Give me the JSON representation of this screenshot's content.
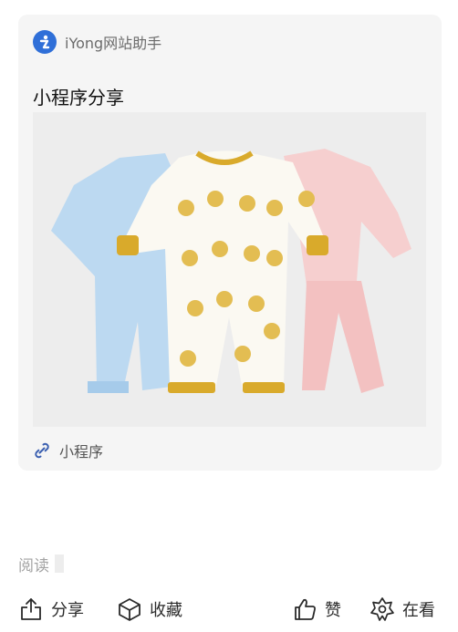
{
  "card": {
    "app_name": "iYong网站助手",
    "title": "小程序分享",
    "mini_program_label": "小程序",
    "thumbnail_icon": "baby-clothes-product-photo",
    "colors": {
      "logo": "#2f6fd8",
      "link_icon": "#3a5fb0"
    }
  },
  "reading": {
    "label": "阅读"
  },
  "actions": {
    "share": {
      "label": "分享",
      "icon": "share-icon"
    },
    "collect": {
      "label": "收藏",
      "icon": "cube-icon"
    },
    "like": {
      "label": "赞",
      "icon": "thumb-up-icon"
    },
    "watching": {
      "label": "在看",
      "icon": "flower-icon"
    }
  }
}
